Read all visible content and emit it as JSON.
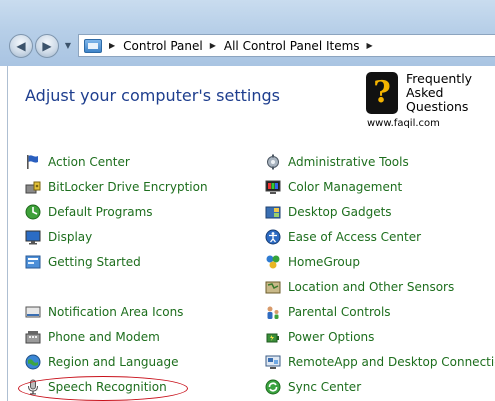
{
  "address": {
    "crumbs": [
      "Control Panel",
      "All Control Panel Items"
    ]
  },
  "header": {
    "title": "Adjust your computer's settings"
  },
  "faq": {
    "line1": "Frequently",
    "line2": "Asked",
    "line3": "Questions",
    "url": "www.faqil.com",
    "logo_char": "?"
  },
  "left_items": [
    {
      "label": "Action Center",
      "icon": "flag-icon"
    },
    {
      "label": "BitLocker Drive Encryption",
      "icon": "bitlocker-icon"
    },
    {
      "label": "Default Programs",
      "icon": "default-programs-icon"
    },
    {
      "label": "Display",
      "icon": "display-icon"
    },
    {
      "label": "Getting Started",
      "icon": "getting-started-icon"
    },
    {
      "label": "Notification Area Icons",
      "icon": "notification-icon"
    },
    {
      "label": "Phone and Modem",
      "icon": "phone-icon"
    },
    {
      "label": "Region and Language",
      "icon": "globe-icon"
    },
    {
      "label": "Speech Recognition",
      "icon": "microphone-icon"
    }
  ],
  "right_items": [
    {
      "label": "Administrative Tools",
      "icon": "admin-tools-icon"
    },
    {
      "label": "Color Management",
      "icon": "color-management-icon"
    },
    {
      "label": "Desktop Gadgets",
      "icon": "gadgets-icon"
    },
    {
      "label": "Ease of Access Center",
      "icon": "ease-of-access-icon"
    },
    {
      "label": "HomeGroup",
      "icon": "homegroup-icon"
    },
    {
      "label": "Location and Other Sensors",
      "icon": "sensors-icon"
    },
    {
      "label": "Parental Controls",
      "icon": "parental-controls-icon"
    },
    {
      "label": "Power Options",
      "icon": "power-icon"
    },
    {
      "label": "RemoteApp and Desktop Connections",
      "icon": "remoteapp-icon"
    },
    {
      "label": "Sync Center",
      "icon": "sync-icon"
    }
  ],
  "colors": {
    "link_green": "#1d6e1d",
    "title_blue": "#1e3e8e",
    "highlight_red": "#c8101a"
  }
}
